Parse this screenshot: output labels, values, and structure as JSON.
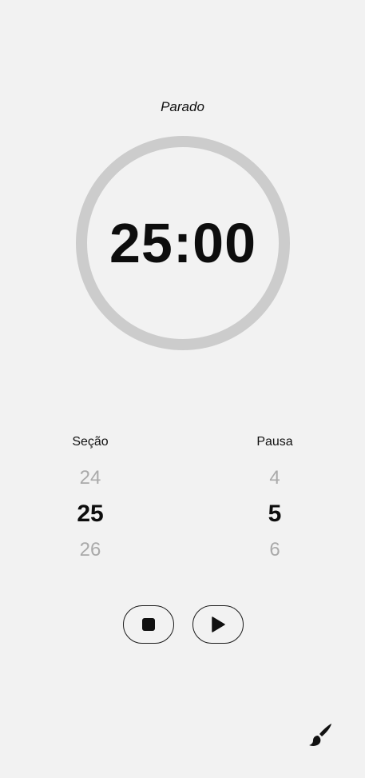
{
  "status": {
    "label": "Parado"
  },
  "timer": {
    "display": "25:00",
    "progress_fraction": 0,
    "ring_color": "#cccccc"
  },
  "session_picker": {
    "label": "Seção",
    "previous": "24",
    "current": "25",
    "next": "26"
  },
  "break_picker": {
    "label": "Pausa",
    "previous": "4",
    "current": "5",
    "next": "6"
  },
  "controls": {
    "stop_icon": "stop-icon",
    "play_icon": "play-icon"
  },
  "theme_button": {
    "icon": "paintbrush-icon"
  },
  "colors": {
    "background": "#f2f2f2",
    "text": "#111111",
    "muted": "#aaaaaa"
  }
}
